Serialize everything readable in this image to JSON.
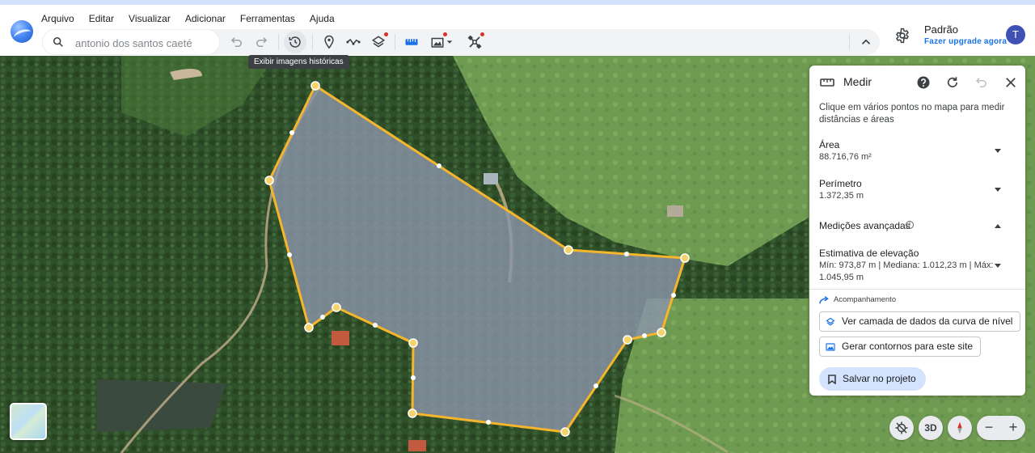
{
  "colors": {
    "accent": "#1a73e8",
    "polygon_stroke": "#f5b52c",
    "polygon_fill": "#8a94a8",
    "avatar": "#3f51b5",
    "save_button": "#d3e3fd",
    "badge_dot": "#d93025"
  },
  "menu": [
    "Arquivo",
    "Editar",
    "Visualizar",
    "Adicionar",
    "Ferramentas",
    "Ajuda"
  ],
  "search": {
    "value": "antonio dos santos caeté"
  },
  "toolbar": {
    "tooltip": "Exibir imagens históricas",
    "icons": [
      "undo-icon",
      "redo-icon",
      "history-icon",
      "placemark-icon",
      "path-icon",
      "layers-icon",
      "ruler-icon",
      "image-overlay-icon",
      "satellite-icon",
      "chevron-up-icon"
    ]
  },
  "user": {
    "name": "Padrão",
    "upgrade": "Fazer upgrade agora",
    "initial": "T"
  },
  "panel": {
    "title": "Medir",
    "description": "Clique em vários pontos no mapa para medir distâncias e áreas",
    "area_label": "Área",
    "area_value": "88.716,76 m²",
    "perimeter_label": "Perímetro",
    "perimeter_value": "1.372,35 m",
    "advanced_label": "Medições avançadas",
    "elevation_label": "Estimativa de elevação",
    "elevation_value": "Mín: 973,87 m | Mediana: 1.012,23 m | Máx: 1.045,95 m",
    "tracking_label": "Acompanhamento",
    "btn_contour_layer": "Ver camada de dados da curva de nível",
    "btn_generate_contours": "Gerar contornos para este site",
    "btn_save": "Salvar no projeto"
  },
  "controls": {
    "threed": "3D",
    "zoom_out": "−",
    "zoom_in": "+"
  }
}
